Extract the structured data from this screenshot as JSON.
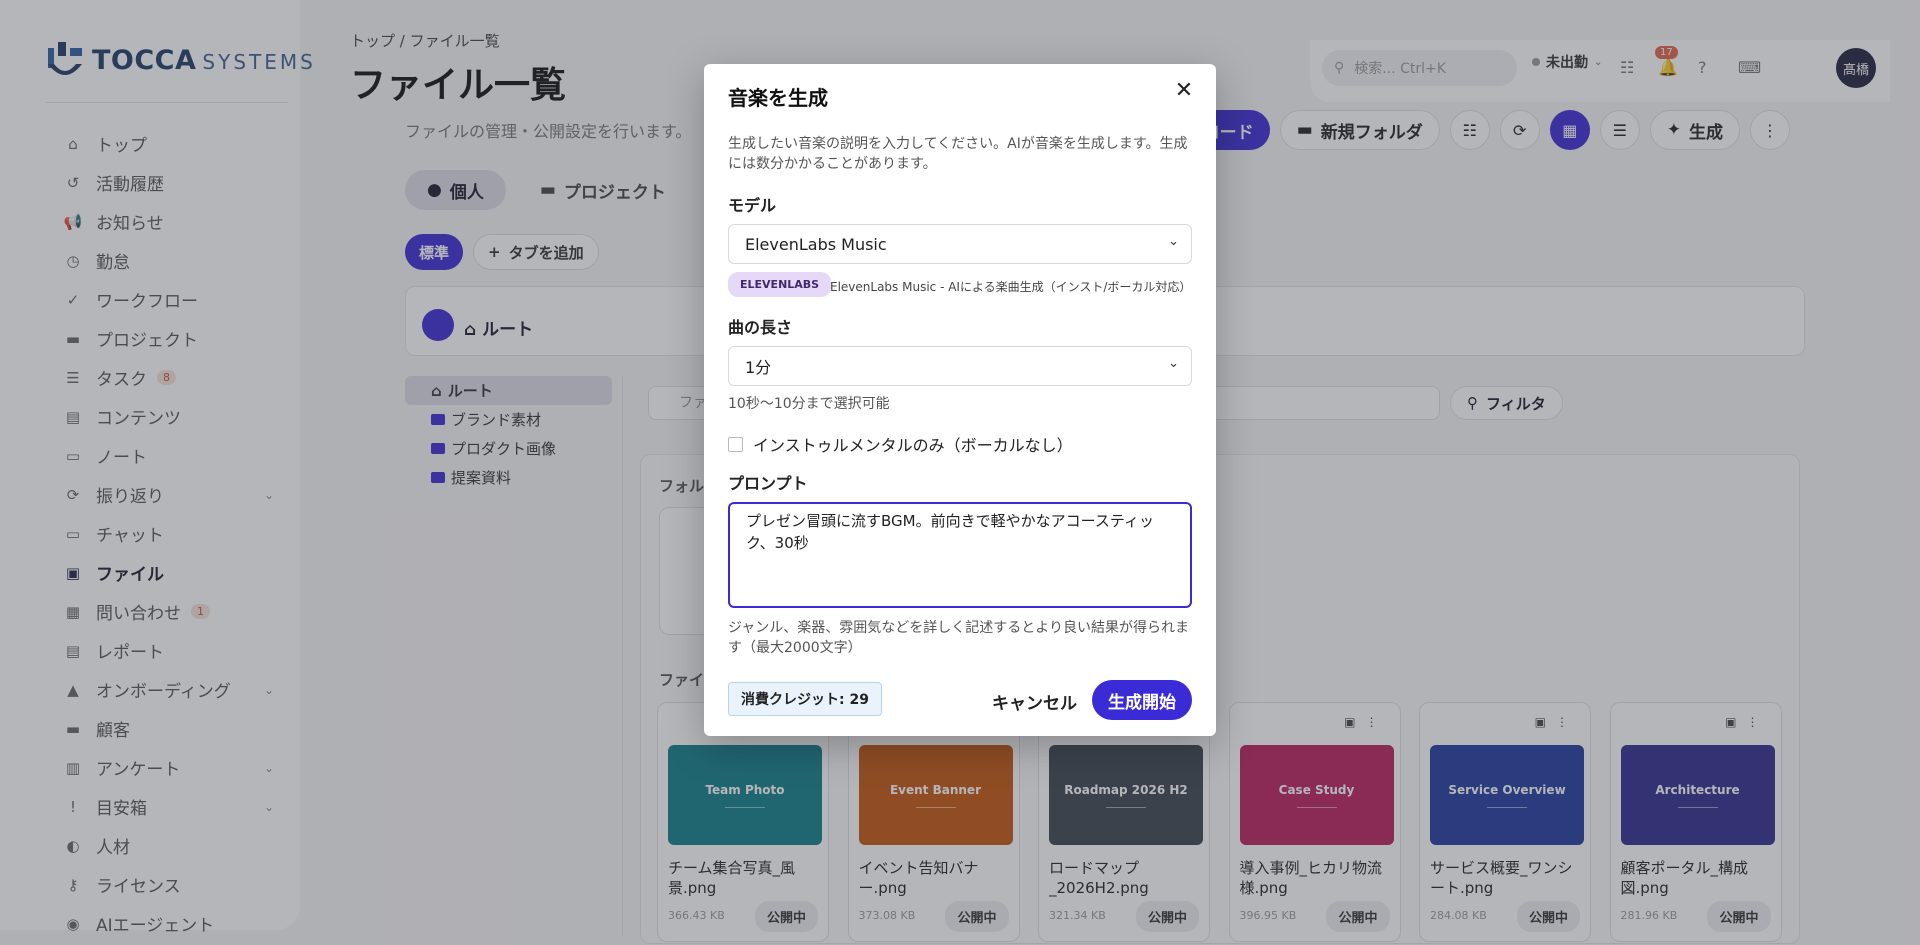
{
  "brand": {
    "name": "TOCCA",
    "suffix": "SYSTEMS"
  },
  "sidebar": {
    "items": [
      {
        "label": "トップ",
        "icon": "home-icon",
        "glyph": "⌂"
      },
      {
        "label": "活動履歴",
        "icon": "history-icon",
        "glyph": "↺"
      },
      {
        "label": "お知らせ",
        "icon": "megaphone-icon",
        "glyph": "📢"
      },
      {
        "label": "勤怠",
        "icon": "clock-icon",
        "glyph": "◷"
      },
      {
        "label": "ワークフロー",
        "icon": "check-circle-icon",
        "glyph": "✓"
      },
      {
        "label": "プロジェクト",
        "icon": "folder-icon",
        "glyph": "▬"
      },
      {
        "label": "タスク",
        "icon": "task-list-icon",
        "glyph": "☰",
        "badge": "8"
      },
      {
        "label": "コンテンツ",
        "icon": "document-icon",
        "glyph": "▤"
      },
      {
        "label": "ノート",
        "icon": "note-icon",
        "glyph": "▭"
      },
      {
        "label": "振り返り",
        "icon": "refresh-icon",
        "glyph": "⟳",
        "caret": true
      },
      {
        "label": "チャット",
        "icon": "chat-icon",
        "glyph": "▭"
      },
      {
        "label": "ファイル",
        "icon": "image-icon",
        "glyph": "▣",
        "active": true
      },
      {
        "label": "問い合わせ",
        "icon": "contact-card-icon",
        "glyph": "▦",
        "badge": "1"
      },
      {
        "label": "レポート",
        "icon": "report-icon",
        "glyph": "▤"
      },
      {
        "label": "オンボーディング",
        "icon": "graduation-icon",
        "glyph": "▲",
        "caret": true
      },
      {
        "label": "顧客",
        "icon": "briefcase-icon",
        "glyph": "▬"
      },
      {
        "label": "アンケート",
        "icon": "chart-icon",
        "glyph": "▥",
        "caret": true
      },
      {
        "label": "目安箱",
        "icon": "feedback-icon",
        "glyph": "!",
        "caret": true
      },
      {
        "label": "人材",
        "icon": "people-icon",
        "glyph": "◐"
      },
      {
        "label": "ライセンス",
        "icon": "key-icon",
        "glyph": "⚷"
      },
      {
        "label": "AIエージェント",
        "icon": "robot-icon",
        "glyph": "◉"
      }
    ]
  },
  "breadcrumb": "トップ  /  ファイル一覧",
  "page": {
    "title": "ファイル一覧",
    "subtitle": "ファイルの管理・公開設定を行います。"
  },
  "topbar": {
    "search_placeholder": "検索... Ctrl+K",
    "status": "未出勤",
    "notifications": "17",
    "avatar": "髙橋"
  },
  "toolbar": {
    "upload": "アップロード",
    "new_folder": "新規フォルダ",
    "generate": "生成"
  },
  "scope_tabs": {
    "personal": "個人",
    "project": "プロジェクト"
  },
  "view_tabs": {
    "standard": "標準",
    "add": "タブを追加"
  },
  "root_label": "ルート",
  "tree": {
    "root": "ルート",
    "items": [
      "ブランド素材",
      "プロダクト画像",
      "提案資料"
    ]
  },
  "filter": {
    "placeholder": "ファイル名で検索",
    "button": "フィルタ"
  },
  "sections": {
    "folders": "フォルダ",
    "files": "ファイル"
  },
  "files": [
    {
      "thumb": "Team Photo",
      "name": "チーム集合写真_風景.png",
      "size": "366.43 KB",
      "status": "公開中",
      "color": "#0f7f8c"
    },
    {
      "thumb": "Event Banner",
      "name": "イベント告知バナー.png",
      "size": "373.08 KB",
      "status": "公開中",
      "color": "#c4560f"
    },
    {
      "thumb": "Roadmap 2026 H2",
      "name": "ロードマップ_2026H2.png",
      "size": "321.34 KB",
      "status": "公開中",
      "color": "#3c4450"
    },
    {
      "thumb": "Case Study",
      "name": "導入事例_ヒカリ物流様.png",
      "size": "396.95 KB",
      "status": "公開中",
      "color": "#b81f5a"
    },
    {
      "thumb": "Service Overview",
      "name": "サービス概要_ワンシート.png",
      "size": "284.08 KB",
      "status": "公開中",
      "color": "#1f3aa0"
    },
    {
      "thumb": "Architecture",
      "name": "顧客ポータル_構成図.png",
      "size": "281.96 KB",
      "status": "公開中",
      "color": "#2e2d8f"
    }
  ],
  "modal": {
    "title": "音楽を生成",
    "description": "生成したい音楽の説明を入力してください。AIが音楽を生成します。生成には数分かかることがあります。",
    "model_label": "モデル",
    "model_value": "ElevenLabs Music",
    "provider_badge": "ELEVENLABS",
    "provider_desc": "ElevenLabs Music - AIによる楽曲生成（インスト/ボーカル対応）",
    "length_label": "曲の長さ",
    "length_value": "1分",
    "length_hint": "10秒〜10分まで選択可能",
    "instrumental_label": "インストゥルメンタルのみ（ボーカルなし）",
    "prompt_label": "プロンプト",
    "prompt_value": "プレゼン冒頭に流すBGM。前向きで軽やかなアコースティック、30秒",
    "prompt_hint": "ジャンル、楽器、雰囲気などを詳しく記述するとより良い結果が得られます（最大2000文字）",
    "credits": "消費クレジット: 29",
    "cancel": "キャンセル",
    "start": "生成開始"
  },
  "colors": {
    "accent": "#3a2bd6",
    "brand": "#1d3b6a"
  }
}
